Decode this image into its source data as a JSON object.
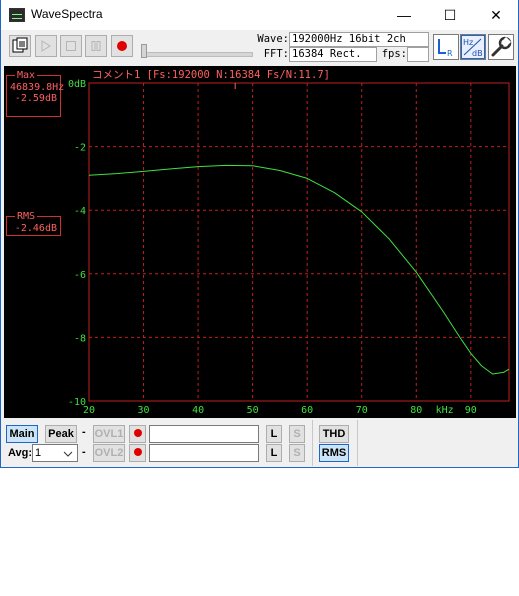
{
  "window": {
    "title": "WaveSpectra"
  },
  "titlebar": {
    "minimize": "—",
    "maximize": "☐",
    "close": "✕"
  },
  "toolbar": {
    "wave_label": "Wave:",
    "wave_value": "192000Hz 16bit 2ch",
    "fft_label": "FFT:",
    "fft_value": "16384 Rect.",
    "fps_label": "fps:",
    "fps_value": ""
  },
  "plot": {
    "comment": "コメント1  [Fs:192000 N:16384 Fs/N:11.7]",
    "yaxis_top_label": "0dB",
    "x_unit": "kHz",
    "bg_color": "#000000",
    "grid_color": "#c02020",
    "trace_color": "#40e040"
  },
  "readouts": {
    "max": {
      "label": "Max",
      "freq": "46839.8Hz",
      "level": "-2.59dB"
    },
    "rms": {
      "label": "RMS",
      "level": "-2.46dB"
    }
  },
  "bottom": {
    "main_label": "Main",
    "peak_label": "Peak",
    "dash1": "-",
    "ovl1_label": "OVL1",
    "avg_label": "Avg:",
    "avg_value": "1",
    "dash2": "-",
    "ovl2_label": "OVL2",
    "l_label": "L",
    "s_label": "S",
    "thd_label": "THD",
    "rms_label": "RMS"
  },
  "chart_data": {
    "type": "line",
    "title": "コメント1  [Fs:192000 N:16384 Fs/N:11.7]",
    "xlabel": "kHz",
    "ylabel": "dB",
    "xlim": [
      20,
      97
    ],
    "ylim": [
      -10,
      0
    ],
    "x_ticks": [
      20,
      30,
      40,
      50,
      60,
      70,
      80,
      90
    ],
    "y_ticks": [
      0,
      -2,
      -4,
      -6,
      -8,
      -10
    ],
    "y_tick_labels": [
      "0dB",
      "-2",
      "-4",
      "-6",
      "-8",
      "-10"
    ],
    "grid": true,
    "series": [
      {
        "x": [
          20,
          25,
          30,
          35,
          40,
          45,
          50,
          55,
          60,
          65,
          70,
          75,
          80,
          85,
          88,
          90,
          92,
          94,
          96,
          97
        ],
        "y": [
          -2.9,
          -2.85,
          -2.78,
          -2.7,
          -2.63,
          -2.59,
          -2.6,
          -2.75,
          -3.0,
          -3.45,
          -4.05,
          -4.9,
          -5.95,
          -7.2,
          -8.0,
          -8.5,
          -8.9,
          -9.15,
          -9.1,
          -9.0
        ]
      }
    ]
  }
}
